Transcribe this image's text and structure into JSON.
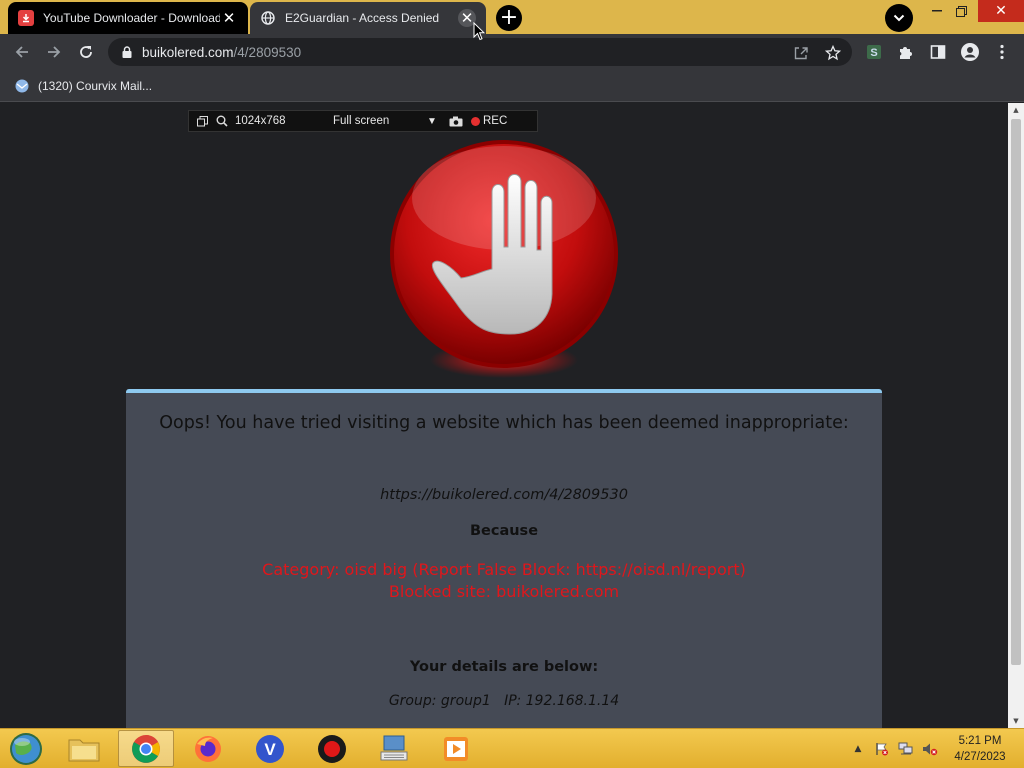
{
  "browser": {
    "tabs": [
      {
        "title": "YouTube Downloader - Download"
      },
      {
        "title": "E2Guardian - Access Denied"
      }
    ],
    "address": {
      "host": "buikolered.com",
      "path": "/4/2809530"
    },
    "bookmarks": [
      {
        "label": "(1320) Courvix Mail..."
      }
    ]
  },
  "recorder_overlay": {
    "resolution": "1024x768",
    "mode": "Full screen",
    "rec_label": "REC"
  },
  "block_page": {
    "headline": "Oops! You have tried visiting a website which has been deemed inappropriate:",
    "blocked_url": "https://buikolered.com/4/2809530",
    "because_label": "Because",
    "reason_line1": "Category: oisd big (Report False Block: https://oisd.nl/report)",
    "reason_line2": "Blocked site: buikolered.com",
    "details_label": "Your details are below:",
    "group_line": "Group: group1   IP: 192.168.1.14"
  },
  "taskbar": {
    "time": "5:21 PM",
    "date": "4/27/2023"
  },
  "colors": {
    "tabstrip": "#ddb64b",
    "reason_text": "#e0161b",
    "panel_bg": "#454a55",
    "panel_top_border": "#8ecaf0"
  }
}
